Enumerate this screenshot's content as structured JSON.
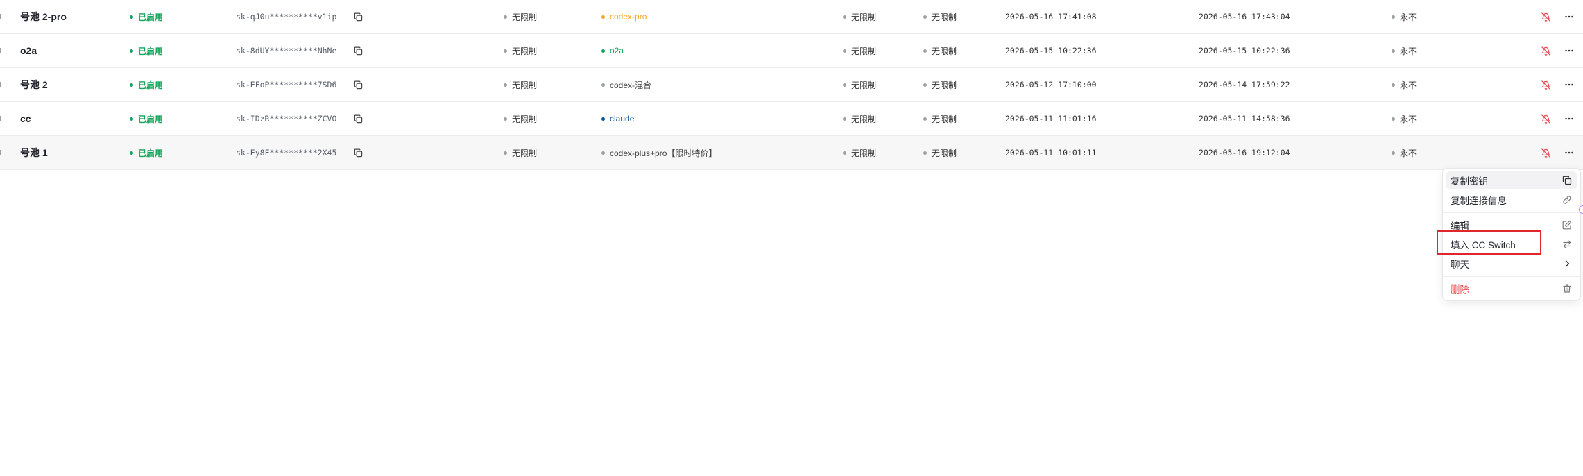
{
  "rows": [
    {
      "name": "号池 2-pro",
      "status": "已启用",
      "key": "sk-qJ0u**********v1ip",
      "quota": "无限制",
      "group": "codex-pro",
      "group_color": "#f5a623",
      "group_has_dot": true,
      "limit_a": "无限制",
      "limit_b": "无限制",
      "created": "2026-05-16 17:41:08",
      "last_used": "2026-05-16 17:43:04",
      "expires": "永不"
    },
    {
      "name": "o2a",
      "status": "已启用",
      "key": "sk-8dUY**********NhNe",
      "quota": "无限制",
      "group": "o2a",
      "group_color": "#12a45a",
      "group_has_dot": true,
      "limit_a": "无限制",
      "limit_b": "无限制",
      "created": "2026-05-15 10:22:36",
      "last_used": "2026-05-15 10:22:36",
      "expires": "永不"
    },
    {
      "name": "号池 2",
      "status": "已启用",
      "key": "sk-EFoP**********7SD6",
      "quota": "无限制",
      "group": "codex-混合",
      "group_color": "#444444",
      "group_has_dot": true,
      "limit_a": "无限制",
      "limit_b": "无限制",
      "created": "2026-05-12 17:10:00",
      "last_used": "2026-05-14 17:59:22",
      "expires": "永不"
    },
    {
      "name": "cc",
      "status": "已启用",
      "key": "sk-IDzR**********ZCVO",
      "quota": "无限制",
      "group": "claude",
      "group_color": "#0b5394",
      "group_has_dot": true,
      "limit_a": "无限制",
      "limit_b": "无限制",
      "created": "2026-05-11 11:01:16",
      "last_used": "2026-05-11 14:58:36",
      "expires": "永不"
    },
    {
      "name": "号池 1",
      "status": "已启用",
      "key": "sk-Ey8F**********2X45",
      "quota": "无限制",
      "group": "codex-plus+pro【限时特价】",
      "group_color": "#444444",
      "group_has_dot": true,
      "limit_a": "无限制",
      "limit_b": "无限制",
      "created": "2026-05-11 10:01:11",
      "last_used": "2026-05-16 19:12:04",
      "expires": "永不"
    }
  ],
  "icons": {
    "copy": "copy-icon",
    "disable": "bell-off-icon",
    "more": "more-horizontal-icon"
  },
  "colors": {
    "status_green": "#12a45a",
    "danger_red": "#e5484d",
    "highlight_red": "#e0262d"
  },
  "menu": {
    "copy_key": "复制密钥",
    "copy_connection": "复制连接信息",
    "edit": "编辑",
    "fill_cc_switch": "填入 CC Switch",
    "chat": "聊天",
    "delete": "删除"
  }
}
